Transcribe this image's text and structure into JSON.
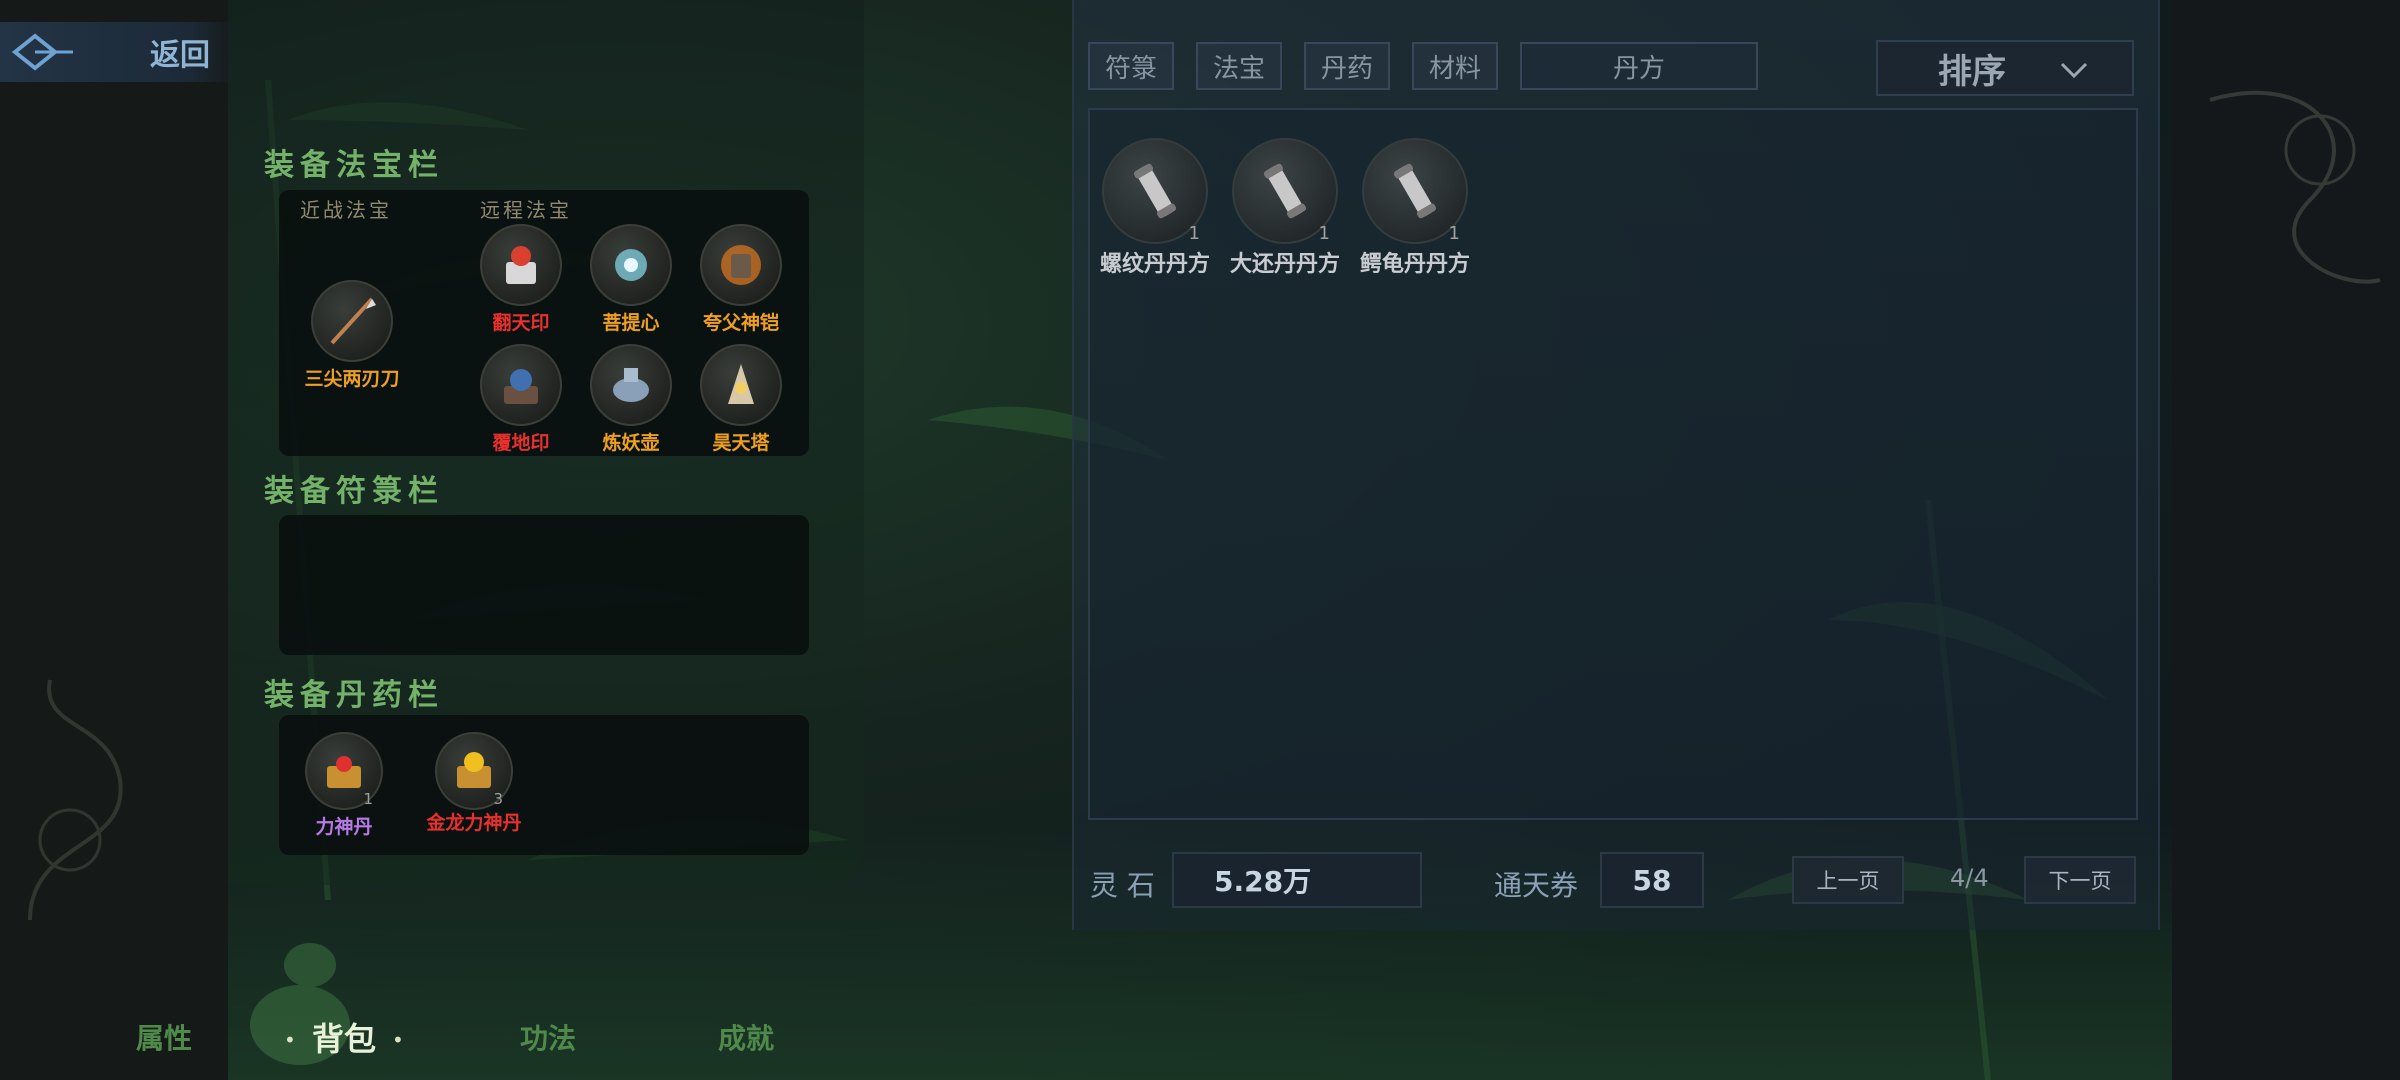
{
  "top": {
    "back_label": "返回"
  },
  "left": {
    "treasure_title": "装备法宝栏",
    "melee_label": "近战法宝",
    "ranged_label": "远程法宝",
    "melee_item": "三尖两刃刀",
    "ranged_items": [
      "翻天印",
      "菩提心",
      "夸父神铠",
      "覆地印",
      "炼妖壶",
      "昊天塔"
    ],
    "talisman_title": "装备符箓栏",
    "pill_title": "装备丹药栏",
    "pills": [
      {
        "name": "力神丹",
        "count": "1"
      },
      {
        "name": "金龙力神丹",
        "count": "3"
      }
    ]
  },
  "right": {
    "tabs": [
      "符箓",
      "法宝",
      "丹药",
      "材料",
      "丹方"
    ],
    "active_tab": "丹方",
    "sort_label": "排序",
    "items": [
      {
        "name": "螺纹丹丹方",
        "count": "1"
      },
      {
        "name": "大还丹丹方",
        "count": "1"
      },
      {
        "name": "鳄龟丹丹方",
        "count": "1"
      }
    ],
    "spirit_stone_label": "灵 石",
    "spirit_stone_value": "5.28万",
    "ticket_label": "通天券",
    "ticket_value": "58",
    "prev_page": "上一页",
    "page_indicator": "4/4",
    "next_page": "下一页"
  },
  "nav": {
    "items": [
      "属性",
      "背包",
      "功法",
      "成就"
    ],
    "active": "背包"
  },
  "colors": {
    "title_green": "#74b26a",
    "rarity_red": "#e8302c",
    "rarity_orange": "#f0a020",
    "rarity_purple": "#b77ae6"
  },
  "icons": [
    "back-arrow-icon",
    "chevron-down-icon",
    "scroll-icon",
    "treasure-chest-icon"
  ]
}
